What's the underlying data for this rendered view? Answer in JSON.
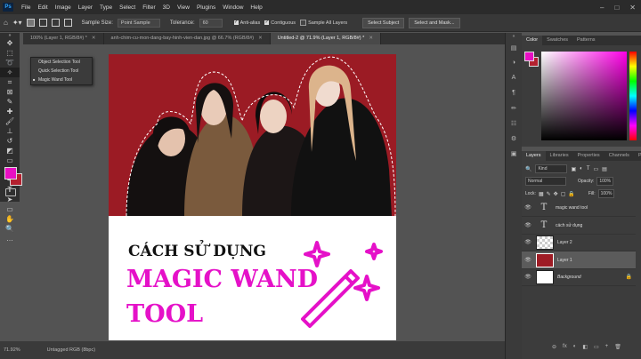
{
  "app": {
    "logo": "Ps"
  },
  "menu": [
    "File",
    "Edit",
    "Image",
    "Layer",
    "Type",
    "Select",
    "Filter",
    "3D",
    "View",
    "Plugins",
    "Window",
    "Help"
  ],
  "window_controls": [
    "–",
    "□",
    "✕"
  ],
  "options": {
    "sample_size_label": "Sample Size:",
    "sample_size_value": "Point Sample",
    "tolerance_label": "Tolerance:",
    "tolerance_value": "60",
    "anti_alias": "Anti-alias",
    "contiguous": "Contiguous",
    "sample_all_layers": "Sample All Layers",
    "select_subject": "Select Subject",
    "select_and_mask": "Select and Mask..."
  },
  "tabs": [
    {
      "label": "100% (Layer 1, RGB/8#) *",
      "active": false
    },
    {
      "label": "anh-chim-cu-mon-dang-bay-hinh-vien-dan.jpg @ 66.7% (RGB/8#)",
      "active": false
    },
    {
      "label": "Untitled-2 @ 71.9% (Layer 1, RGB/8#) *",
      "active": true
    }
  ],
  "flyout": [
    {
      "label": "Object Selection Tool",
      "selected": false
    },
    {
      "label": "Quick Selection Tool",
      "selected": false
    },
    {
      "label": "Magic Wand Tool",
      "selected": true
    }
  ],
  "canvas": {
    "line1": "CÁCH SỬ DỤNG",
    "line2": "MAGIC WAND",
    "line3": "TOOL"
  },
  "status": {
    "zoom": "71.92%",
    "profile": "Untagged RGB (8bpc)"
  },
  "color_panel": {
    "tabs": [
      "Color",
      "Swatches",
      "Patterns"
    ]
  },
  "layers_panel": {
    "tabs": [
      "Layers",
      "Libraries",
      "Properties",
      "Channels",
      "Paths"
    ],
    "kind": "Kind",
    "blend": "Normal",
    "opacity_label": "Opacity:",
    "opacity_value": "100%",
    "lock_label": "Lock:",
    "fill_label": "Fill:",
    "fill_value": "100%",
    "layers": [
      {
        "name": "magic wand tool",
        "type": "text",
        "selected": false
      },
      {
        "name": "cách sử dụng",
        "type": "text",
        "selected": false
      },
      {
        "name": "Layer 2",
        "type": "empty",
        "selected": false
      },
      {
        "name": "Layer 1",
        "type": "photo",
        "selected": true
      },
      {
        "name": "Background",
        "type": "white",
        "selected": false
      }
    ],
    "footer_icons": [
      "⊖",
      "fx",
      "◐",
      "◧",
      "▭",
      "+",
      "🗑"
    ]
  },
  "colors": {
    "foreground": "#e80fc3",
    "background": "#b3212f",
    "accent_text": "#e511c8"
  }
}
